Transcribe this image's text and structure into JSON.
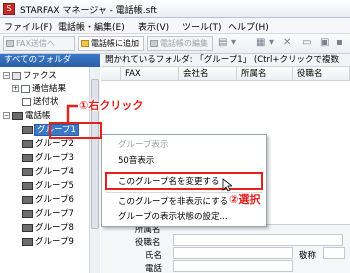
{
  "window": {
    "title": "STARFAX マネージャ - 電話帳.sft"
  },
  "menubar": [
    "ファイル(F)",
    "電話帳・編集(E)",
    "表示(V)",
    "ツール(T)",
    "ヘルプ(H)"
  ],
  "toolbar": {
    "fax_send": "FAX送信へ",
    "add_to_phonebook": "電話帳に追加",
    "edit_phonebook": "電話帳の編集"
  },
  "left_pane": {
    "header": "すべてのフォルダ",
    "tree": [
      "ファクス",
      "通信結果",
      "送付状",
      "電話帳",
      "グループ1",
      "グループ2",
      "グループ3",
      "グループ4",
      "グループ5",
      "グループ6",
      "グループ7",
      "グループ8",
      "グループ9"
    ]
  },
  "right_pane": {
    "folder_bar": "開かれているフォルダ: 「グループ1」 (Ctrl+クリックで複数",
    "columns": [
      "FAX",
      "会社名",
      "所属名",
      "役職名"
    ],
    "detail_labels": [
      "所属名",
      "役職名",
      "氏名",
      "電話"
    ],
    "detail_extra": "敬称"
  },
  "context_menu": {
    "items": [
      "グループ表示",
      "50音表示",
      "このグループ名を変更する",
      "このグループを非表示にする",
      "グループの表示状態の設定..."
    ]
  },
  "annotations": {
    "right_click": "①右クリック",
    "select": "②選択",
    "accent_color": "#e0231b"
  }
}
